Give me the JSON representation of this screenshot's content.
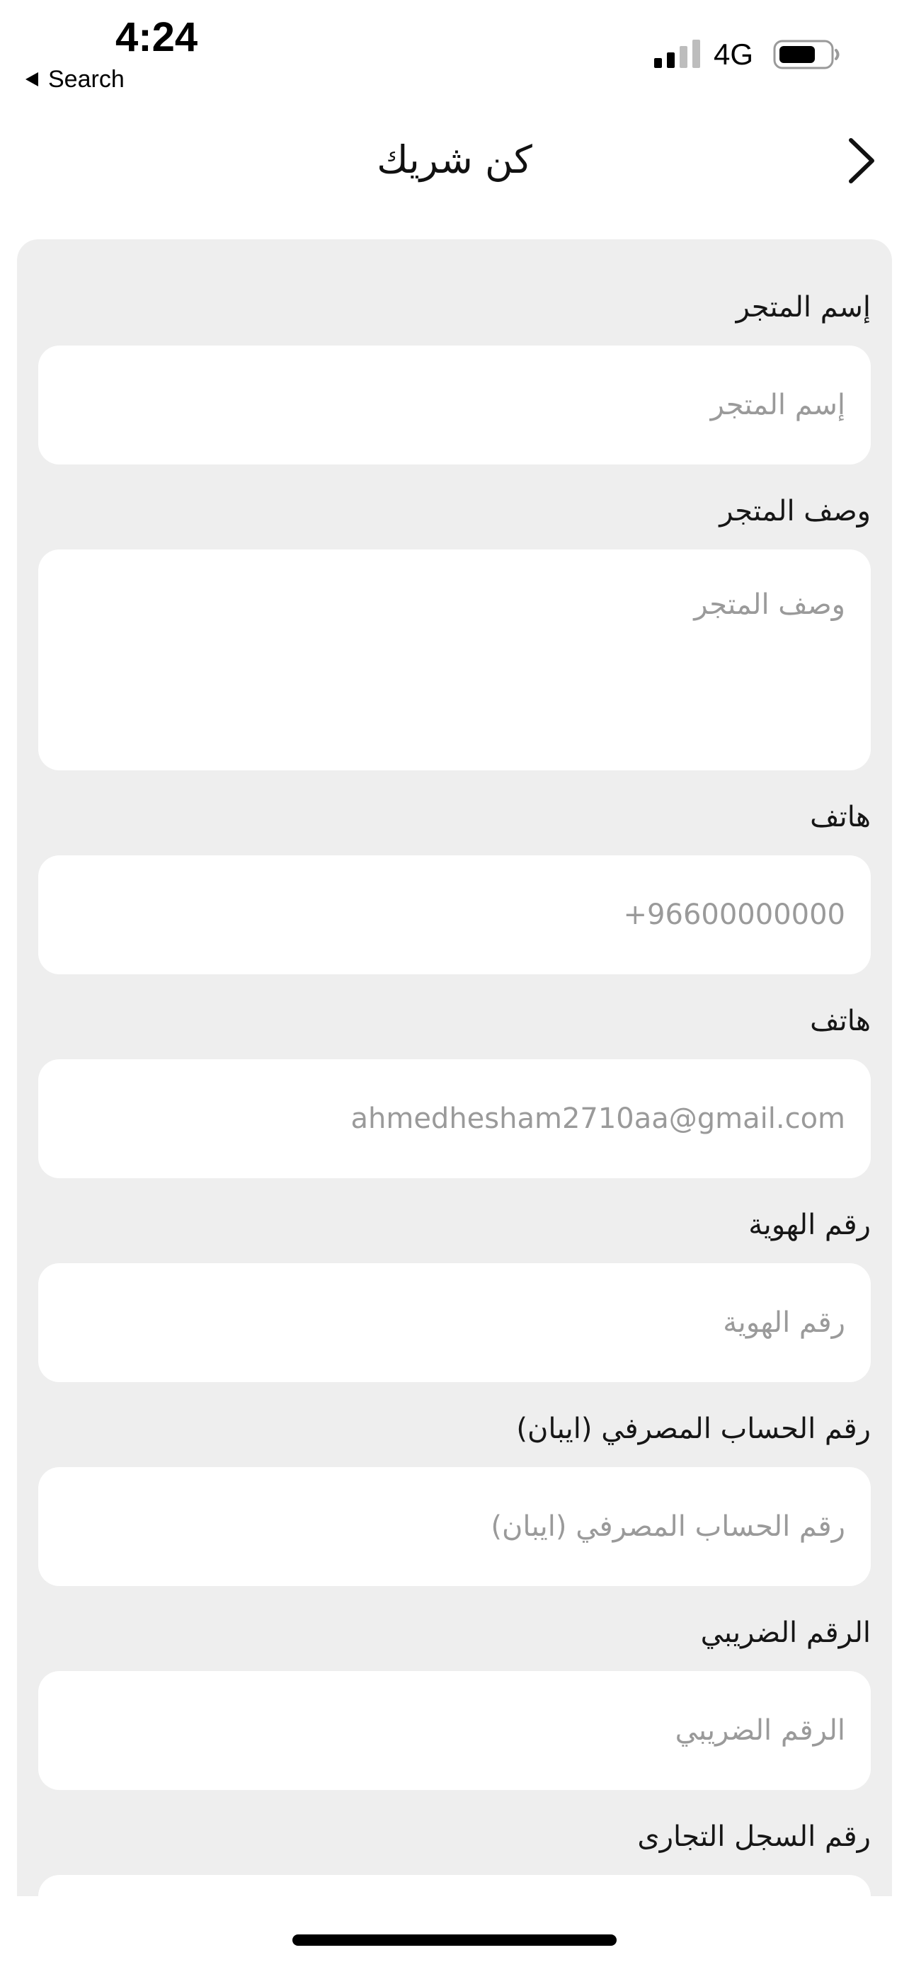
{
  "status_bar": {
    "time": "4:24",
    "back_label": "Search",
    "network": "4G",
    "icons": [
      "signal-icon",
      "battery-icon",
      "back-triangle-icon"
    ]
  },
  "header": {
    "title": "كن شريك",
    "chevron_icon": "chevron-right-icon"
  },
  "form": {
    "store_name": {
      "label": "إسم المتجر",
      "placeholder": "إسم المتجر"
    },
    "store_description": {
      "label": "وصف المتجر",
      "placeholder": "وصف المتجر"
    },
    "phone": {
      "label": "هاتف",
      "placeholder": "+96600000000"
    },
    "email": {
      "label": "هاتف",
      "placeholder": "ahmedhesham2710aa@gmail.com"
    },
    "id_number": {
      "label": "رقم الهوية",
      "placeholder": "رقم الهوية"
    },
    "iban": {
      "label": "رقم الحساب المصرفي (ايبان)",
      "placeholder": "رقم الحساب المصرفي (ايبان)"
    },
    "tax_number": {
      "label": "الرقم الضريبي",
      "placeholder": "الرقم الضريبي"
    },
    "commercial_register": {
      "label": "رقم السجل التجارى",
      "placeholder": ""
    }
  },
  "colors": {
    "card_background": "#eeeeee",
    "field_background": "#ffffff",
    "placeholder": "#9a9a9a",
    "text": "#111111"
  }
}
